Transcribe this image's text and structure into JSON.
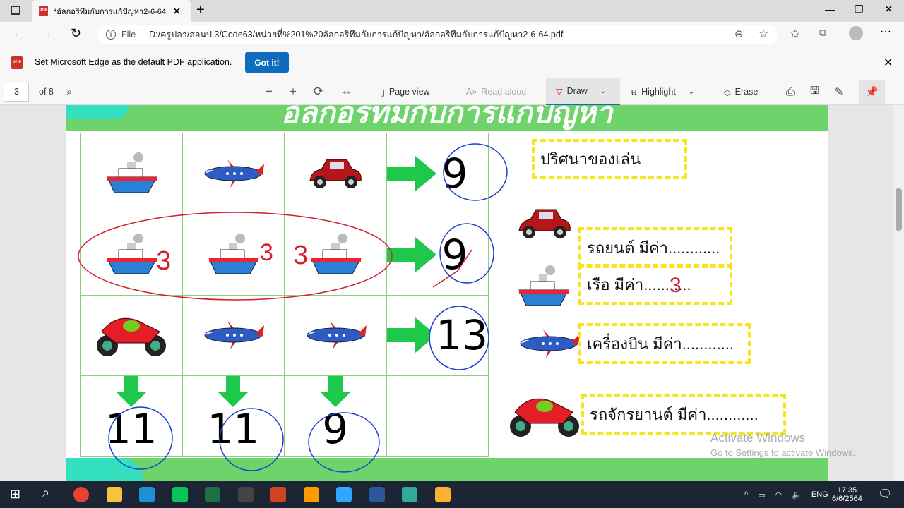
{
  "browser": {
    "tab_title": "*อัลกอริทึมกับการแก้ปัญหา2-6-64.pdf",
    "url_prefix": "File",
    "url": "D:/ครูปลา/สอนป.3/Code63/หน่วยที่%201%20อัลกอริทึมกับการแก้ปัญหา/อัลกอริทึมกับการแก้ปัญหา2-6-64.pdf"
  },
  "infobar": {
    "message": "Set Microsoft Edge as the default PDF application.",
    "button": "Got it!"
  },
  "pdf_toolbar": {
    "page": "3",
    "of": "of 8",
    "page_view": "Page view",
    "read_aloud": "Read aloud",
    "draw": "Draw",
    "highlight": "Highlight",
    "erase": "Erase"
  },
  "worksheet": {
    "header": "อัลกอริทึมกับการแก้ปัญหา",
    "grid": [
      [
        "ship",
        "plane",
        "car",
        "9"
      ],
      [
        "ship",
        "ship",
        "ship",
        "9"
      ],
      [
        "motorbike",
        "plane",
        "plane",
        "13"
      ],
      [
        "11",
        "11",
        "9",
        ""
      ]
    ],
    "annotations": {
      "ship_marks": [
        "3",
        "3",
        "3"
      ],
      "ship_value": "3"
    },
    "legend_title": "ปริศนาของเล่น",
    "legend": [
      {
        "icon": "car",
        "text": "รถยนต์ มีค่า............"
      },
      {
        "icon": "ship",
        "text": "เรือ มีค่า..........."
      },
      {
        "icon": "plane",
        "text": "เครื่องบิน มีค่า............"
      },
      {
        "icon": "motorbike",
        "text": "รถจักรยานต์ มีค่า............"
      }
    ]
  },
  "watermark": {
    "title": "Activate Windows",
    "subtitle": "Go to Settings to activate Windows."
  },
  "taskbar": {
    "lang": "ENG",
    "time": "17:35",
    "date": "6/6/2564"
  },
  "colors": {
    "green": "#6dd36a",
    "arrow": "#1ec84a",
    "dash": "#f5e51b",
    "ink_red": "#d02030",
    "ink_blue": "#1a3fd0"
  }
}
